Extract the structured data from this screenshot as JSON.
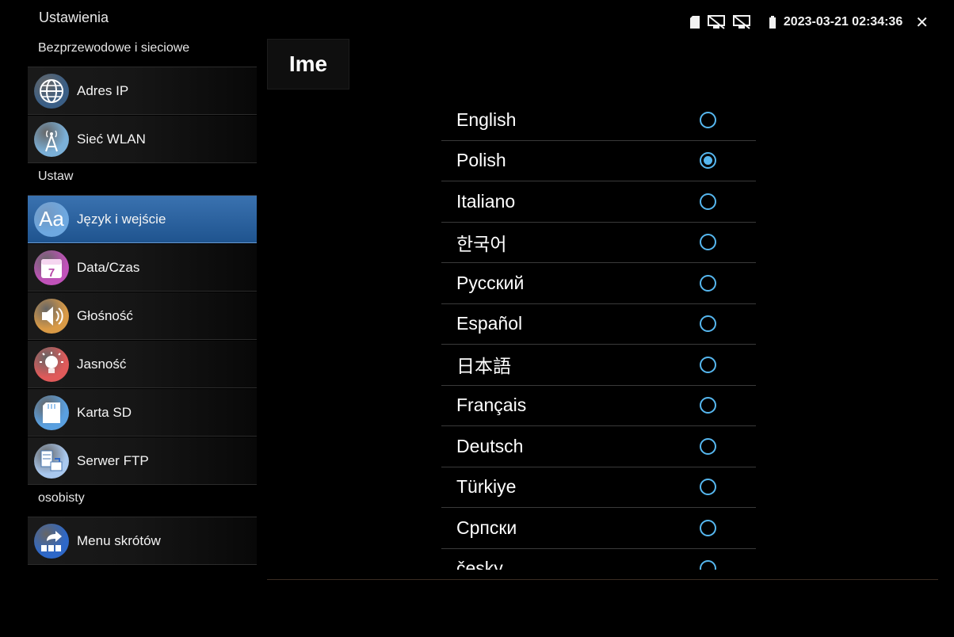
{
  "app": {
    "title": "Ustawienia"
  },
  "status": {
    "datetime": "2023-03-21 02:34:36",
    "icons": [
      "sd-card-icon",
      "screen-off-icon",
      "screen-off-icon",
      "battery-icon"
    ],
    "close": "✕"
  },
  "sidebar": {
    "sections": [
      {
        "header": "Bezprzewodowe i sieciowe",
        "items": [
          {
            "label": "Adres IP",
            "icon": "globe-icon",
            "color": "#3b5f86",
            "selected": false
          },
          {
            "label": "Sieć WLAN",
            "icon": "wlan-antenna-icon",
            "color": "#7bb0d8",
            "selected": false
          }
        ]
      },
      {
        "header": "Ustaw",
        "items": [
          {
            "label": "Język i wejście",
            "icon": "language-aa-icon",
            "color": "#6ea8e0",
            "selected": true
          },
          {
            "label": "Data/Czas",
            "icon": "calendar-icon",
            "color": "#c052b9",
            "selected": false
          },
          {
            "label": "Głośność",
            "icon": "speaker-icon",
            "color": "#d99a46",
            "selected": false
          },
          {
            "label": "Jasność",
            "icon": "lightbulb-icon",
            "color": "#e05a5a",
            "selected": false
          },
          {
            "label": "Karta SD",
            "icon": "sd-card-icon",
            "color": "#5aa0e0",
            "selected": false
          },
          {
            "label": "Serwer FTP",
            "icon": "ftp-server-icon",
            "color": "#a9c8ee",
            "selected": false
          }
        ]
      },
      {
        "header": "osobisty",
        "items": [
          {
            "label": "Menu skrótów",
            "icon": "shortcut-icon",
            "color": "#2e68c8",
            "selected": false
          }
        ]
      }
    ]
  },
  "panel": {
    "title": "Ime",
    "languages": [
      {
        "label": "English",
        "selected": false
      },
      {
        "label": "Polish",
        "selected": true
      },
      {
        "label": "Italiano",
        "selected": false
      },
      {
        "label": "한국어",
        "selected": false
      },
      {
        "label": "Русский",
        "selected": false
      },
      {
        "label": "Español",
        "selected": false
      },
      {
        "label": "日本語",
        "selected": false
      },
      {
        "label": "Français",
        "selected": false
      },
      {
        "label": "Deutsch",
        "selected": false
      },
      {
        "label": "Türkiye",
        "selected": false
      },
      {
        "label": "Српски",
        "selected": false
      },
      {
        "label": "česky",
        "selected": false
      }
    ]
  },
  "colors": {
    "accent": "#56b7ef",
    "selected_bg": "#2d64a0"
  }
}
